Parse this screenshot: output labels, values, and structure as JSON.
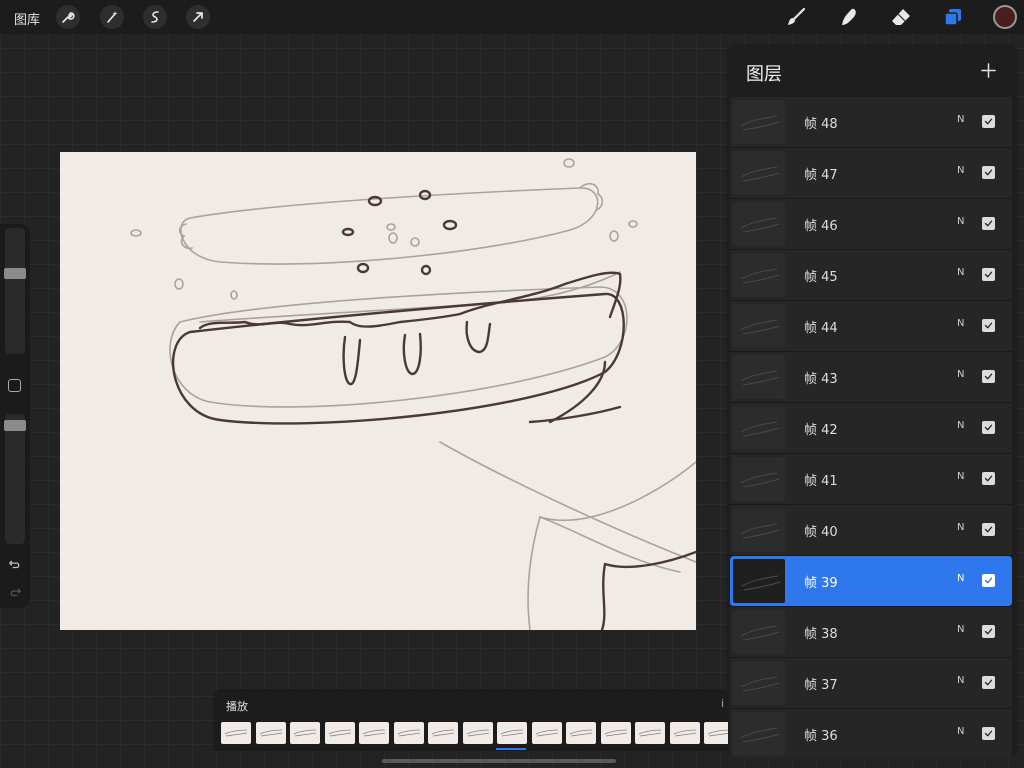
{
  "app": {
    "gallery_label": "图库"
  },
  "toolbar": {
    "left_tools": [
      "wrench-icon",
      "magic-wand-icon",
      "selection-icon",
      "transform-arrow-icon"
    ],
    "right_tools": [
      "brush-icon",
      "smudge-icon",
      "eraser-icon",
      "layers-icon"
    ],
    "active_tool": "layers-icon",
    "accent_color": "#2f77ec",
    "current_color": "#4a1e1e"
  },
  "sidebar": {
    "brush_size_level": 0.3,
    "opacity_level": 0.05,
    "undo_icon": "undo-icon",
    "redo_icon": "redo-icon"
  },
  "layers_panel": {
    "title": "图层",
    "add_icon": "plus-icon",
    "layers": [
      {
        "name": "帧 48",
        "blend": "N",
        "visible": true,
        "selected": false
      },
      {
        "name": "帧 47",
        "blend": "N",
        "visible": true,
        "selected": false
      },
      {
        "name": "帧 46",
        "blend": "N",
        "visible": true,
        "selected": false
      },
      {
        "name": "帧 45",
        "blend": "N",
        "visible": true,
        "selected": false
      },
      {
        "name": "帧 44",
        "blend": "N",
        "visible": true,
        "selected": false
      },
      {
        "name": "帧 43",
        "blend": "N",
        "visible": true,
        "selected": false
      },
      {
        "name": "帧 42",
        "blend": "N",
        "visible": true,
        "selected": false
      },
      {
        "name": "帧 41",
        "blend": "N",
        "visible": true,
        "selected": false
      },
      {
        "name": "帧 40",
        "blend": "N",
        "visible": true,
        "selected": false
      },
      {
        "name": "帧 39",
        "blend": "N",
        "visible": true,
        "selected": true
      },
      {
        "name": "帧 38",
        "blend": "N",
        "visible": true,
        "selected": false
      },
      {
        "name": "帧 37",
        "blend": "N",
        "visible": true,
        "selected": false
      },
      {
        "name": "帧 36",
        "blend": "N",
        "visible": true,
        "selected": false
      }
    ]
  },
  "timeline": {
    "play_label": "播放",
    "frame_count": 15,
    "current_frame_index": 8
  }
}
